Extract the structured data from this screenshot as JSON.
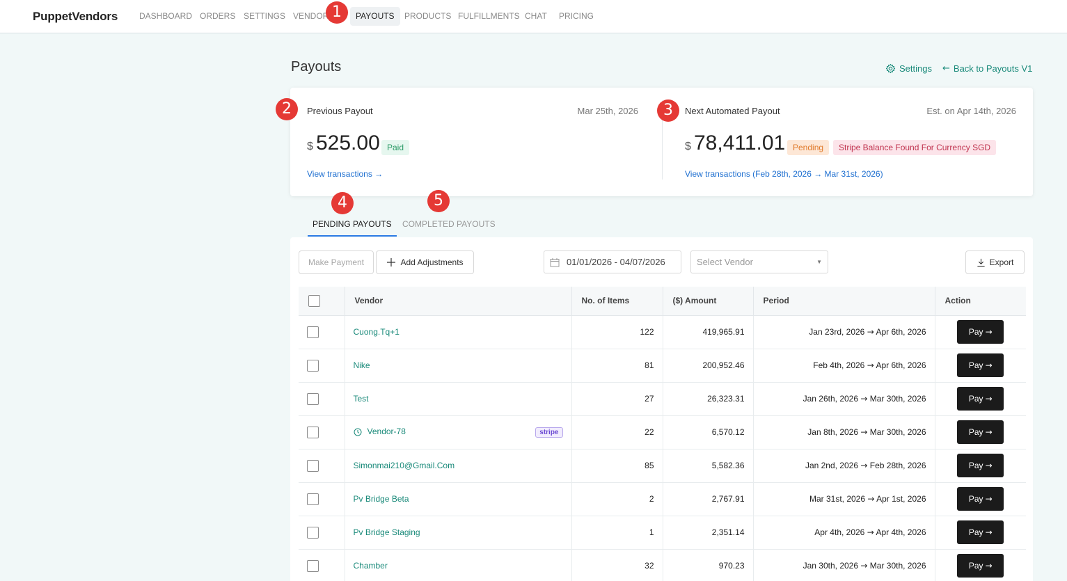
{
  "nav": {
    "brand": "PuppetVendors",
    "items": [
      "DASHBOARD",
      "ORDERS",
      "SETTINGS",
      "VENDORS",
      "PAYOUTS",
      "PRODUCTS",
      "FULFILLMENTS",
      "CHAT",
      "PRICING"
    ],
    "active": "PAYOUTS"
  },
  "markers": [
    "1",
    "2",
    "3",
    "4",
    "5"
  ],
  "page": {
    "title": "Payouts",
    "settings_link": "Settings",
    "back_link": "Back to Payouts V1"
  },
  "previous_payout": {
    "label": "Previous Payout",
    "date": "Mar 25th, 2026",
    "currency": "$",
    "amount": "525.00",
    "status": "Paid",
    "link": "View transactions →"
  },
  "next_payout": {
    "label": "Next Automated Payout",
    "date": "Est. on Apr 14th, 2026",
    "currency": "$",
    "amount": "78,411.01",
    "status": "Pending",
    "warning": "Stripe Balance Found For Currency SGD",
    "link": "View transactions (Feb 28th, 2026 → Mar 31st, 2026)"
  },
  "tabs": {
    "pending": "PENDING PAYOUTS",
    "completed": "COMPLETED PAYOUTS"
  },
  "toolbar": {
    "make_payment": "Make Payment",
    "add_adjustments": "Add Adjustments",
    "date_range": "01/01/2026 - 04/07/2026",
    "vendor_placeholder": "Select Vendor",
    "export": "Export"
  },
  "table": {
    "headers": {
      "vendor": "Vendor",
      "items": "No. of Items",
      "amount": "($) Amount",
      "period": "Period",
      "action": "Action"
    },
    "pay_label": "Pay",
    "stripe_tag": "stripe",
    "rows": [
      {
        "vendor": "Cuong.Tq+1",
        "items": "122",
        "amount": "419,965.91",
        "start": "Jan 23rd, 2026",
        "end": "Apr 6th, 2026"
      },
      {
        "vendor": "Nike",
        "items": "81",
        "amount": "200,952.46",
        "start": "Feb 4th, 2026",
        "end": "Apr 6th, 2026"
      },
      {
        "vendor": "Test",
        "items": "27",
        "amount": "26,323.31",
        "start": "Jan 26th, 2026",
        "end": "Mar 30th, 2026"
      },
      {
        "vendor": "Vendor-78",
        "items": "22",
        "amount": "6,570.12",
        "start": "Jan 8th, 2026",
        "end": "Mar 30th, 2026"
      },
      {
        "vendor": "Simonmai210@Gmail.Com",
        "items": "85",
        "amount": "5,582.36",
        "start": "Jan 2nd, 2026",
        "end": "Feb 28th, 2026"
      },
      {
        "vendor": "Pv Bridge Beta",
        "items": "2",
        "amount": "2,767.91",
        "start": "Mar 31st, 2026",
        "end": "Apr 1st, 2026"
      },
      {
        "vendor": "Pv Bridge Staging",
        "items": "1",
        "amount": "2,351.14",
        "start": "Apr 4th, 2026",
        "end": "Apr 4th, 2026"
      },
      {
        "vendor": "Chamber",
        "items": "32",
        "amount": "970.23",
        "start": "Jan 30th, 2026",
        "end": "Mar 30th, 2026"
      }
    ]
  },
  "colors": {
    "accent_teal": "#1a8a7a",
    "link_blue": "#1e6fd0",
    "marker_red": "#e53935",
    "tab_underline": "#2c7be5"
  }
}
